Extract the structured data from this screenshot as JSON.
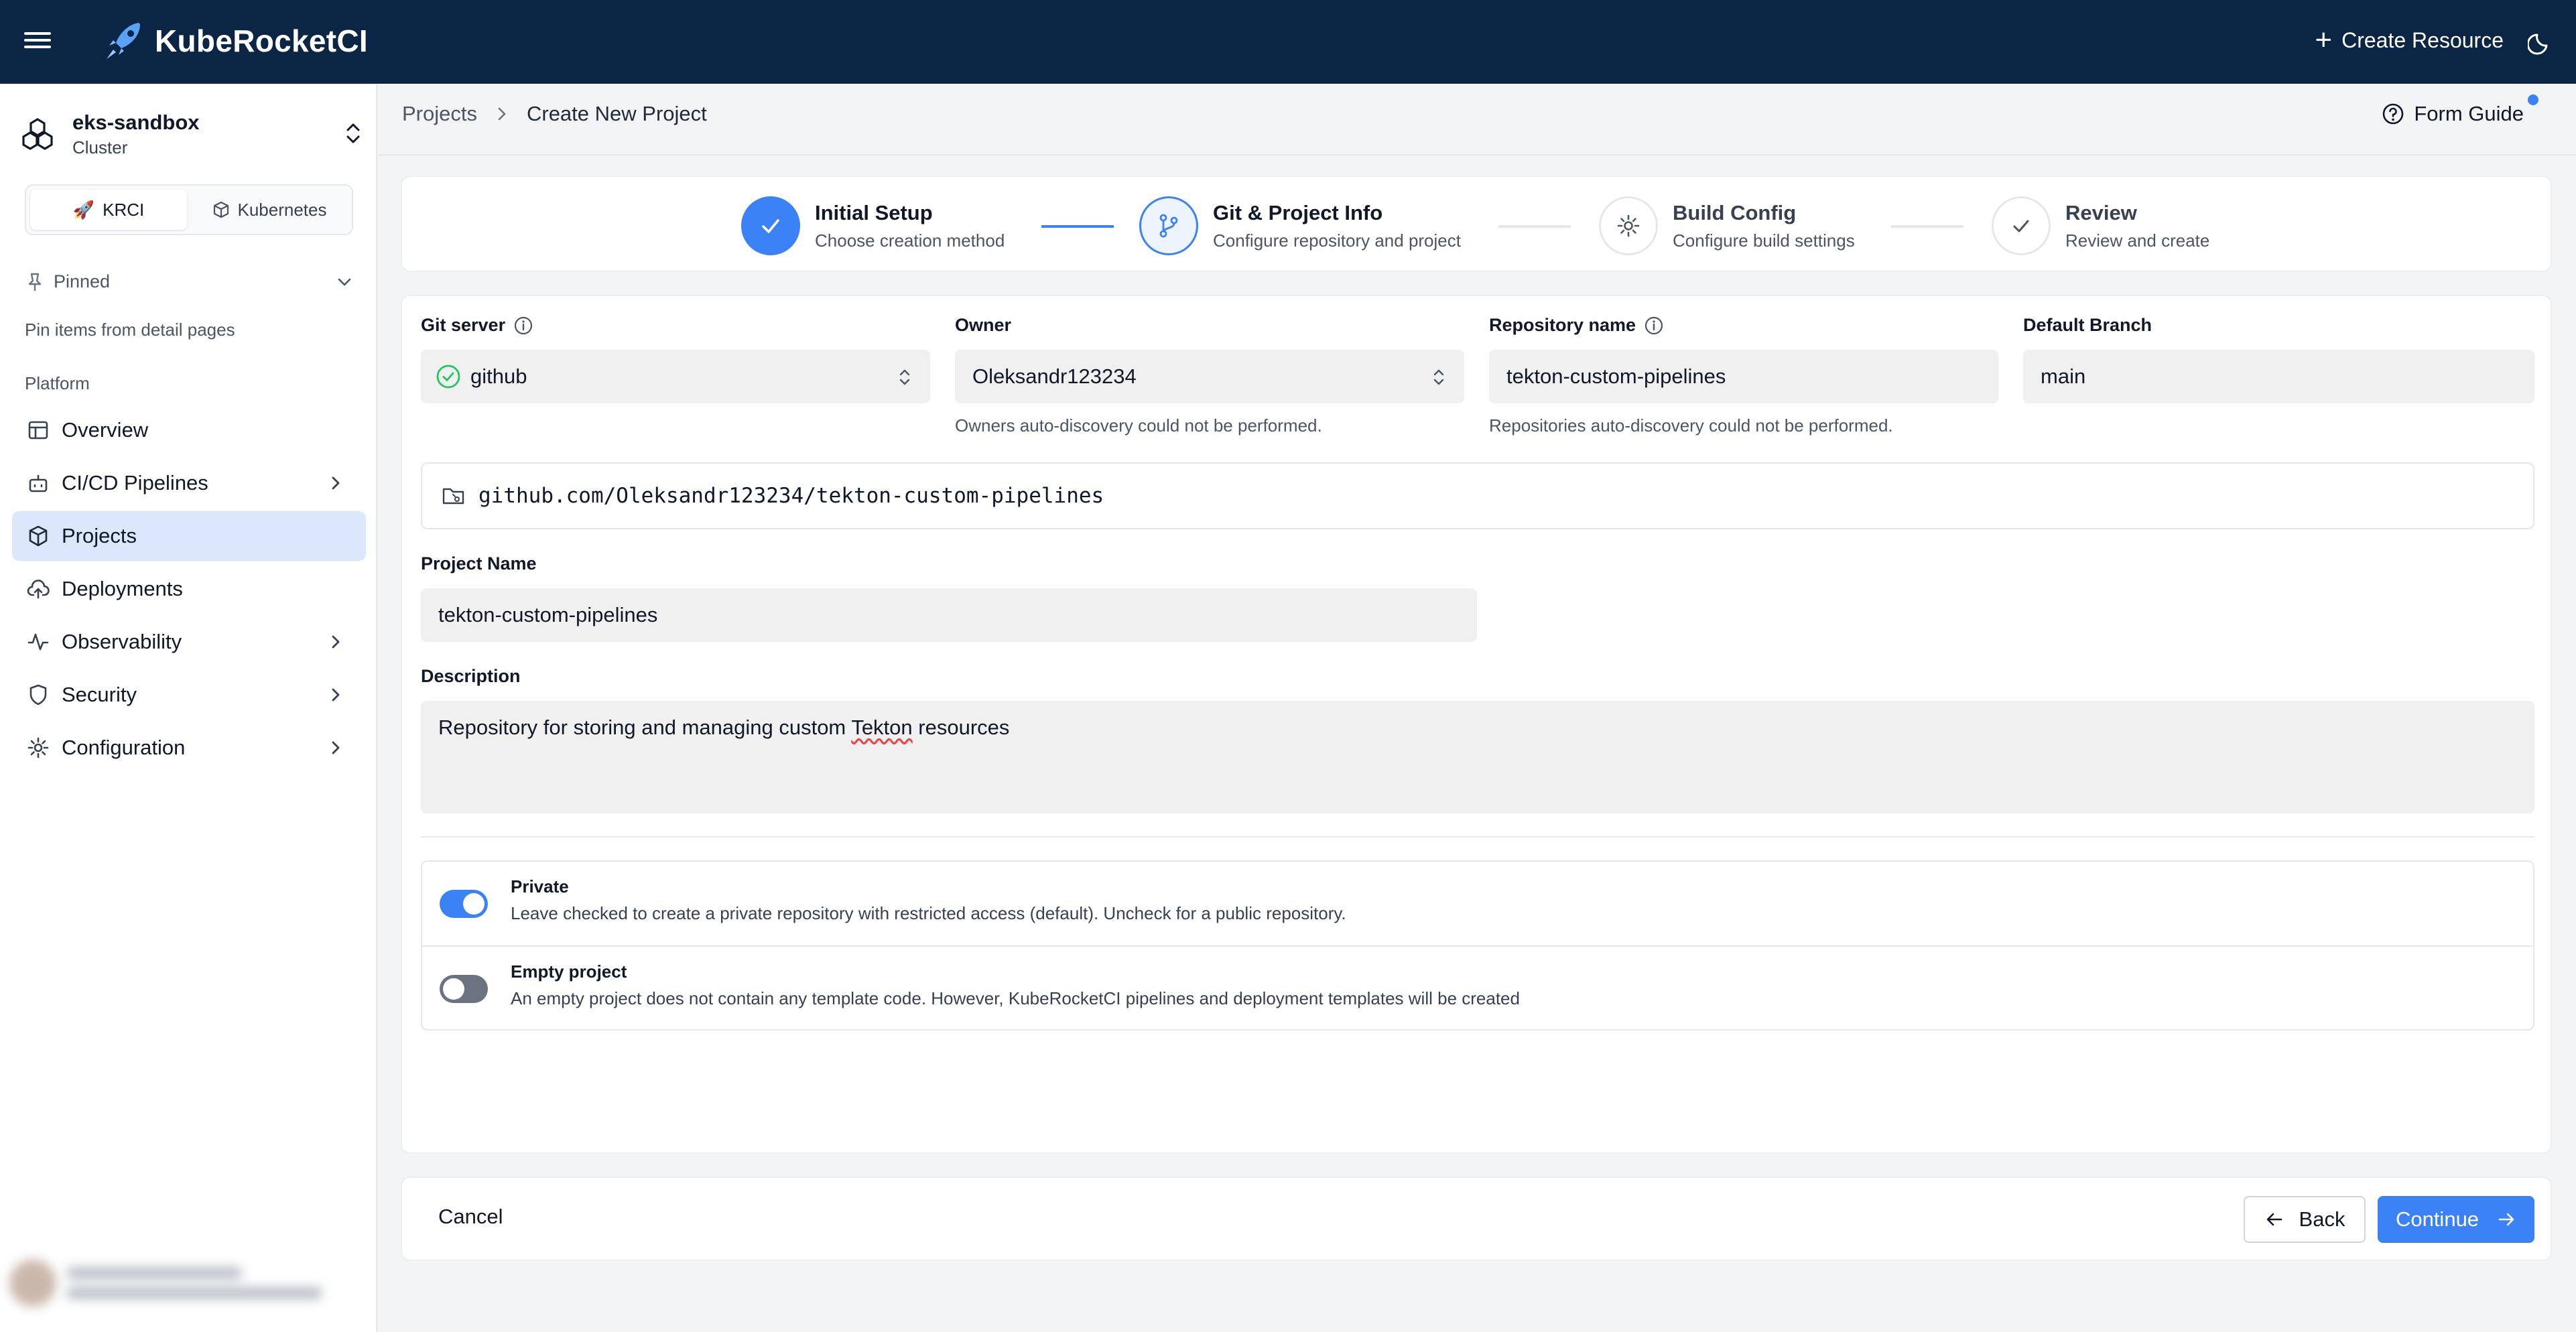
{
  "header": {
    "app_name": "KubeRocketCI",
    "create_resource_label": "Create Resource",
    "icons": {
      "menu": "hamburger-icon",
      "logo": "rocket-logo-icon",
      "plus": "plus-icon",
      "theme": "moon-icon"
    }
  },
  "sidebar": {
    "cluster_name": "eks-sandbox",
    "cluster_type": "Cluster",
    "segment": {
      "krci_label": "KRCI",
      "kubernetes_label": "Kubernetes",
      "active": "KRCI"
    },
    "pinned_label": "Pinned",
    "pinned_hint": "Pin items from detail pages",
    "section_label": "Platform",
    "items": [
      {
        "label": "Overview",
        "icon": "table-layout-icon",
        "has_children": false
      },
      {
        "label": "CI/CD Pipelines",
        "icon": "bot-icon",
        "has_children": true
      },
      {
        "label": "Projects",
        "icon": "box-icon",
        "has_children": false,
        "active": true
      },
      {
        "label": "Deployments",
        "icon": "cloud-upload-icon",
        "has_children": false
      },
      {
        "label": "Observability",
        "icon": "activity-icon",
        "has_children": true
      },
      {
        "label": "Security",
        "icon": "shield-icon",
        "has_children": true
      },
      {
        "label": "Configuration",
        "icon": "gear-icon",
        "has_children": true
      }
    ]
  },
  "breadcrumb": {
    "parent": "Projects",
    "current": "Create New Project"
  },
  "form_guide_label": "Form Guide",
  "stepper": {
    "active_index": 1,
    "steps": [
      {
        "title": "Initial Setup",
        "subtitle": "Choose creation method",
        "status": "completed"
      },
      {
        "title": "Git & Project Info",
        "subtitle": "Configure repository and project",
        "status": "current"
      },
      {
        "title": "Build Config",
        "subtitle": "Configure build settings",
        "status": "pending"
      },
      {
        "title": "Review",
        "subtitle": "Review and create",
        "status": "pending"
      }
    ]
  },
  "form": {
    "git_server": {
      "label": "Git server",
      "value": "github",
      "status": "ok"
    },
    "owner": {
      "label": "Owner",
      "value": "Oleksandr123234",
      "hint": "Owners auto-discovery could not be performed."
    },
    "repository_name": {
      "label": "Repository name",
      "value": "tekton-custom-pipelines",
      "hint": "Repositories auto-discovery could not be performed."
    },
    "default_branch": {
      "label": "Default Branch",
      "value": "main"
    },
    "repo_url": "github.com/Oleksandr123234/tekton-custom-pipelines",
    "project_name": {
      "label": "Project Name",
      "value": "tekton-custom-pipelines"
    },
    "description": {
      "label": "Description",
      "value_before": "Repository for storing and managing custom ",
      "value_flagged": "Tekton",
      "value_after": " resources"
    },
    "private": {
      "label": "Private",
      "description": "Leave checked to create a private repository with restricted access (default). Uncheck for a public repository.",
      "checked": true
    },
    "empty_project": {
      "label": "Empty project",
      "description": "An empty project does not contain any template code. However, KubeRocketCI pipelines and deployment templates will be created",
      "checked": false
    }
  },
  "footer": {
    "cancel_label": "Cancel",
    "back_label": "Back",
    "continue_label": "Continue"
  },
  "colors": {
    "header_bg": "#0b2545",
    "accent": "#3b82f6",
    "active_nav_bg": "#dbe7fb",
    "success": "#22c55e"
  }
}
